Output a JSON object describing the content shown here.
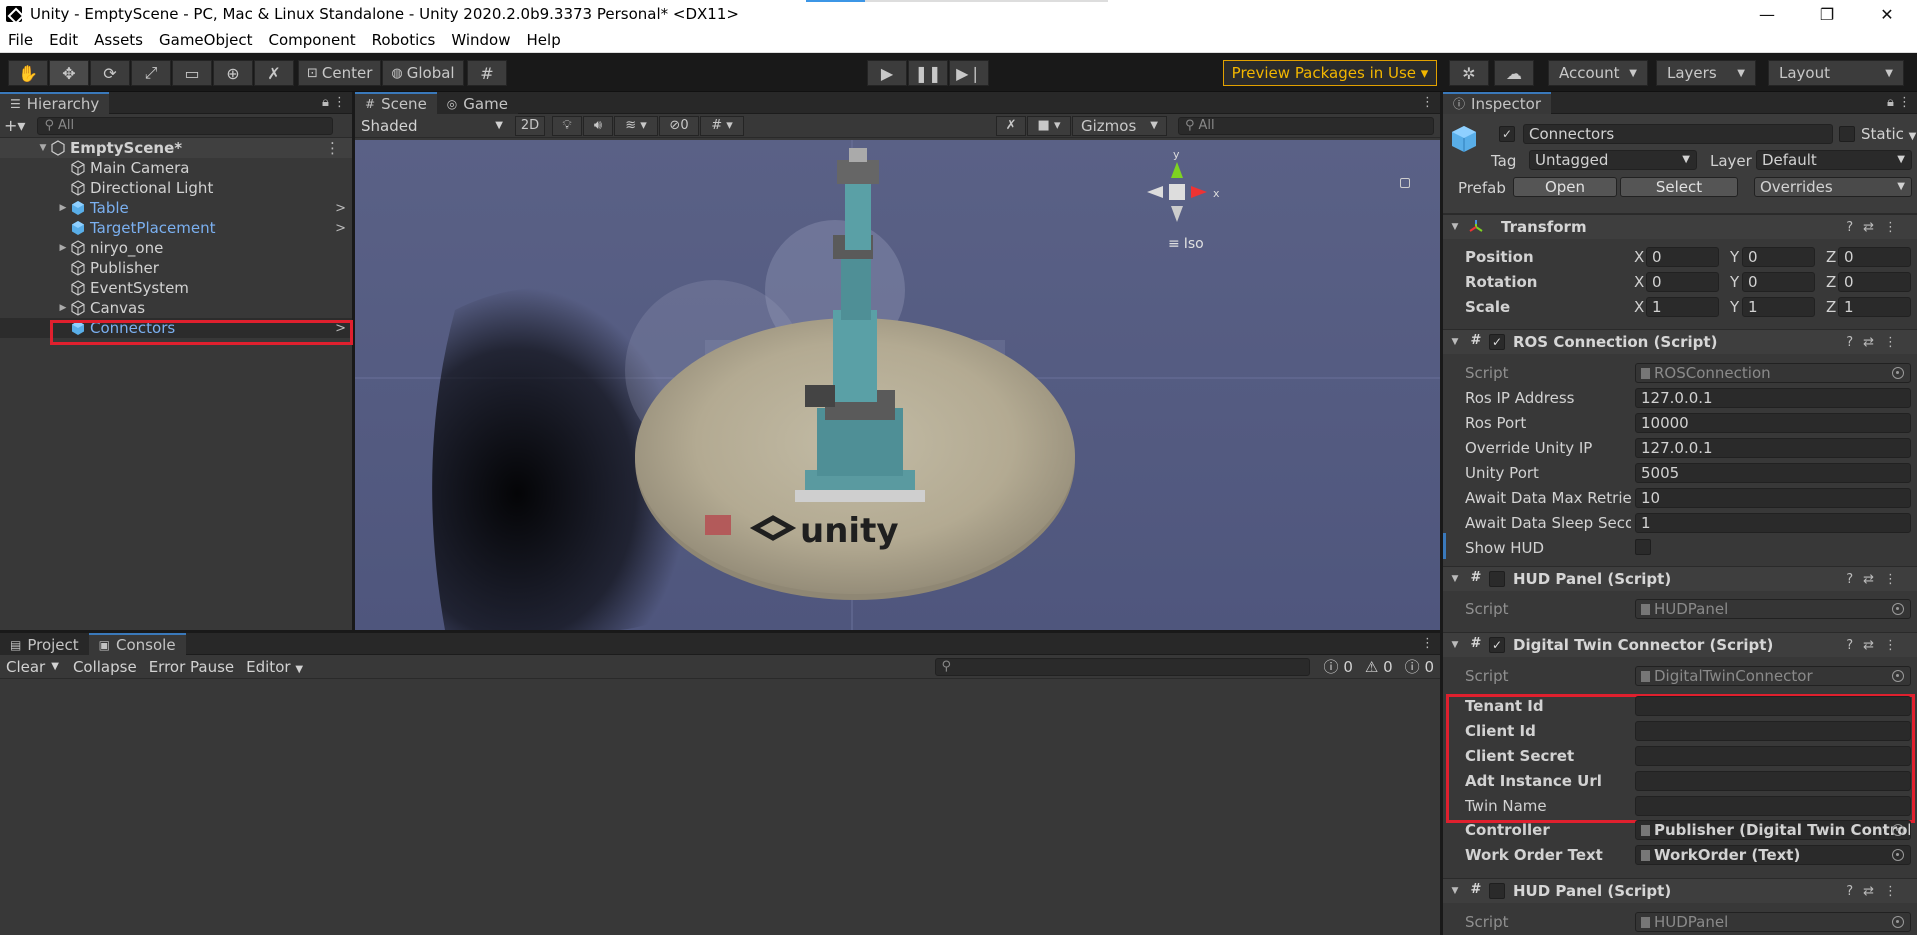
{
  "window": {
    "title": "Unity - EmptyScene - PC, Mac & Linux Standalone - Unity 2020.2.0b9.3373 Personal* <DX11>",
    "minimize": "—",
    "maximize": "❐",
    "close": "✕"
  },
  "menu": [
    "File",
    "Edit",
    "Assets",
    "GameObject",
    "Component",
    "Robotics",
    "Window",
    "Help"
  ],
  "toolbar": {
    "center": "Center",
    "global": "Global",
    "preview_packages": "Preview Packages in Use ▾",
    "account": "Account",
    "layers": "Layers",
    "layout": "Layout"
  },
  "hierarchy": {
    "tab": "Hierarchy",
    "search_placeholder": "All",
    "scene": "EmptyScene*",
    "items": [
      {
        "label": "Main Camera",
        "blue": false,
        "expand": false
      },
      {
        "label": "Directional Light",
        "blue": false,
        "expand": false
      },
      {
        "label": "Table",
        "blue": true,
        "expand": true
      },
      {
        "label": "TargetPlacement",
        "blue": true,
        "expand": false
      },
      {
        "label": "niryo_one",
        "blue": false,
        "expand": true
      },
      {
        "label": "Publisher",
        "blue": false,
        "expand": false
      },
      {
        "label": "EventSystem",
        "blue": false,
        "expand": false
      },
      {
        "label": "Canvas",
        "blue": false,
        "expand": true
      },
      {
        "label": "Connectors",
        "blue": true,
        "expand": false,
        "selected": true
      }
    ]
  },
  "scene": {
    "tabs": [
      "Scene",
      "Game"
    ],
    "shading": "Shaded",
    "mode_2d": "2D",
    "hidden_count": "0",
    "gizmos": "Gizmos",
    "search_placeholder": "All",
    "projection": "Iso",
    "table_logo": "unity"
  },
  "console": {
    "tabs": [
      "Project",
      "Console"
    ],
    "clear": "Clear",
    "collapse": "Collapse",
    "error_pause": "Error Pause",
    "editor": "Editor",
    "log_count": "0",
    "warn_count": "0",
    "error_count": "0"
  },
  "inspector": {
    "tab": "Inspector",
    "object_name": "Connectors",
    "static": "Static",
    "tag_label": "Tag",
    "tag_value": "Untagged",
    "layer_label": "Layer",
    "layer_value": "Default",
    "prefab_label": "Prefab",
    "prefab_open": "Open",
    "prefab_select": "Select",
    "prefab_overrides": "Overrides",
    "transform": {
      "title": "Transform",
      "position_label": "Position",
      "rotation_label": "Rotation",
      "scale_label": "Scale",
      "position": [
        "0",
        "0",
        "0"
      ],
      "rotation": [
        "0",
        "0",
        "0"
      ],
      "scale": [
        "1",
        "1",
        "1"
      ]
    },
    "ros": {
      "title": "ROS Connection (Script)",
      "script_label": "Script",
      "script": "ROSConnection",
      "fields": [
        {
          "label": "Ros IP Address",
          "value": "127.0.0.1"
        },
        {
          "label": "Ros Port",
          "value": "10000"
        },
        {
          "label": "Override Unity IP",
          "value": "127.0.0.1"
        },
        {
          "label": "Unity Port",
          "value": "5005"
        },
        {
          "label": "Await Data Max Retries",
          "value": "10"
        },
        {
          "label": "Await Data Sleep Seconds",
          "value": "1"
        }
      ],
      "show_hud": "Show HUD"
    },
    "hud1": {
      "title": "HUD Panel (Script)",
      "script_label": "Script",
      "script": "HUDPanel"
    },
    "dtc": {
      "title": "Digital Twin Connector (Script)",
      "script_label": "Script",
      "script": "DigitalTwinConnector",
      "fields": [
        {
          "label": "Tenant Id",
          "value": ""
        },
        {
          "label": "Client Id",
          "value": ""
        },
        {
          "label": "Client Secret",
          "value": ""
        },
        {
          "label": "Adt Instance Url",
          "value": ""
        },
        {
          "label": "Twin Name",
          "value": ""
        }
      ],
      "controller_label": "Controller",
      "controller": "Publisher (Digital Twin Controlle",
      "work_order_label": "Work Order Text",
      "work_order": "WorkOrder (Text)"
    },
    "hud2": {
      "title": "HUD Panel (Script)",
      "script_label": "Script",
      "script": "HUDPanel"
    }
  },
  "colors": {
    "accent": "#3a79bb",
    "highlight": "#e0202e",
    "preview": "#f2b600"
  }
}
